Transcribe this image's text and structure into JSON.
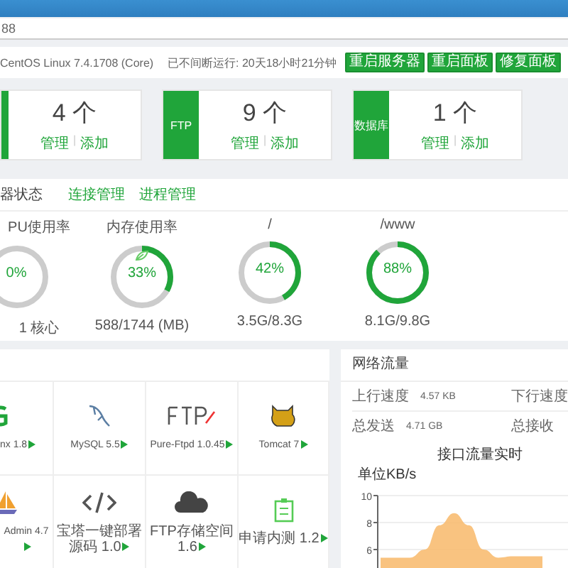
{
  "address": {
    "text": "88"
  },
  "system": {
    "os": "CentOS Linux 7.4.1708 (Core)",
    "uptime": "已不间断运行: 20天18小时21分钟",
    "buttons": [
      "重启服务器",
      "重启面板",
      "修复面板"
    ]
  },
  "counts": [
    {
      "count": "4 个",
      "links": [
        "管理",
        "添加"
      ],
      "separator": "|"
    },
    {
      "label": "FTP",
      "count": "9 个",
      "links": [
        "管理",
        "添加"
      ],
      "separator": "|"
    },
    {
      "label": "数据库",
      "count": "1 个",
      "links": [
        "管理",
        "添加"
      ],
      "separator": "|"
    }
  ],
  "status": {
    "title": "器状态",
    "links": [
      "连接管理",
      "进程管理"
    ],
    "gauges": [
      {
        "title": "PU使用率",
        "value": "0%",
        "level": 0,
        "detail": "1 核心",
        "boost_icon": false
      },
      {
        "title": "内存使用率",
        "value": "33%",
        "level": 0.33,
        "detail": "588/1744 (MB)",
        "boost_icon": true
      },
      {
        "title": "/",
        "value": "42%",
        "level": 0.42,
        "detail": "3.5G/8.3G",
        "boost_icon": false
      },
      {
        "title": "/www",
        "value": "88%",
        "level": 0.88,
        "detail": "8.1G/9.8G",
        "boost_icon": false
      }
    ]
  },
  "software": {
    "items": [
      {
        "name": "nx 1.8",
        "kind": "nginx"
      },
      {
        "name": "MySQL 5.5",
        "kind": "mysql"
      },
      {
        "name": "Pure-Ftpd 1.0.45",
        "kind": "ftp"
      },
      {
        "name": "Tomcat 7",
        "kind": "tomcat"
      },
      {
        "name": "Admin 4.7",
        "kind": "boat"
      },
      {
        "name": "宝塔一键部署源码 1.0",
        "kind": "code"
      },
      {
        "name": "FTP存储空间 1.6",
        "kind": "cloud"
      },
      {
        "name": "申请内测 1.2",
        "kind": "clipboard"
      }
    ]
  },
  "network": {
    "title": "网络流量",
    "stats": [
      {
        "label": "上行速度",
        "value": "4.57 KB"
      },
      {
        "label": "下行速度"
      },
      {
        "label": "总发送",
        "value": "4.71 GB"
      },
      {
        "label": "总接收"
      }
    ],
    "chart": {
      "title": "接口流量实时",
      "unit": "单位KB/s",
      "chart_data": {
        "type": "area",
        "ylim": [
          4,
          10
        ],
        "yticks": [
          6,
          8,
          10
        ],
        "series": [
          {
            "color": "#f8b86a",
            "values": [
              5.4,
              5.4,
              5.4,
              6.0,
              7.8,
              8.7,
              7.8,
              6.0,
              5.4,
              5.5,
              5.5,
              5.5
            ]
          }
        ]
      }
    }
  }
}
